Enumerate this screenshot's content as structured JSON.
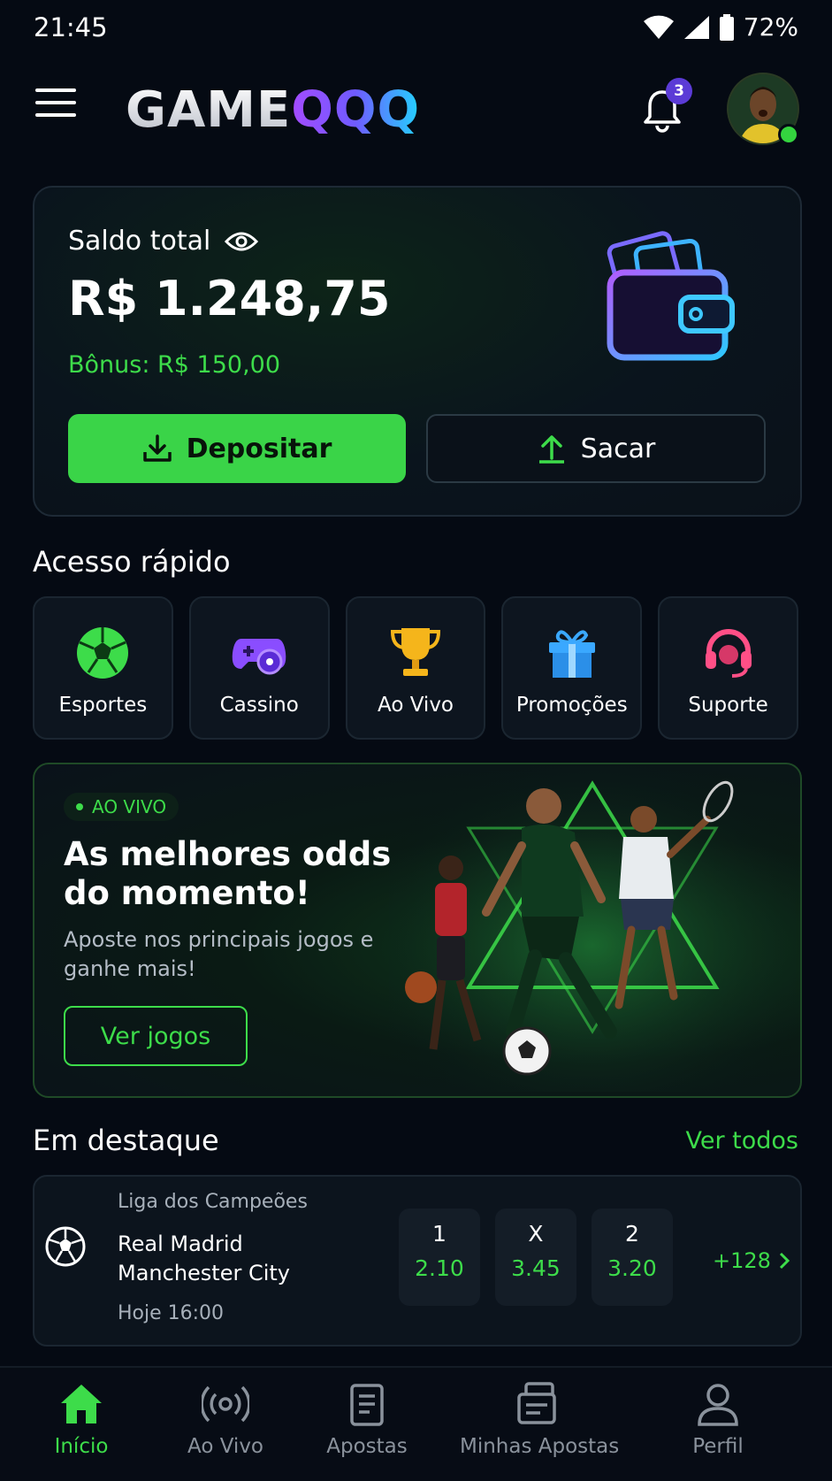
{
  "status_bar": {
    "time": "21:45",
    "battery": "72%"
  },
  "header": {
    "logo_part1": "GAME",
    "logo_part2": "QQQ",
    "notification_count": "3"
  },
  "balance": {
    "label": "Saldo total",
    "value": "R$ 1.248,75",
    "bonus": "Bônus: R$ 150,00",
    "deposit_label": "Depositar",
    "withdraw_label": "Sacar"
  },
  "quick_access": {
    "title": "Acesso rápido",
    "items": [
      {
        "label": "Esportes",
        "icon": "soccer-ball-icon"
      },
      {
        "label": "Cassino",
        "icon": "gamepad-icon"
      },
      {
        "label": "Ao Vivo",
        "icon": "trophy-icon"
      },
      {
        "label": "Promoções",
        "icon": "gift-icon"
      },
      {
        "label": "Suporte",
        "icon": "headset-icon"
      }
    ]
  },
  "promo": {
    "tag": "AO VIVO",
    "title": "As melhores odds do momento!",
    "subtitle": "Aposte nos principais jogos e ganhe mais!",
    "button": "Ver jogos"
  },
  "featured": {
    "title": "Em destaque",
    "see_all": "Ver todos",
    "match": {
      "league": "Liga dos Campeões",
      "home": "Real Madrid",
      "away": "Manchester City",
      "time": "Hoje 16:00",
      "odds": [
        {
          "label": "1",
          "value": "2.10"
        },
        {
          "label": "X",
          "value": "3.45"
        },
        {
          "label": "2",
          "value": "3.20"
        }
      ],
      "more_markets": "+128"
    }
  },
  "bottom_nav": [
    {
      "label": "Início",
      "icon": "home-icon",
      "active": true
    },
    {
      "label": "Ao Vivo",
      "icon": "broadcast-icon"
    },
    {
      "label": "Apostas",
      "icon": "clipboard-icon"
    },
    {
      "label": "Minhas Apostas",
      "icon": "tickets-icon"
    },
    {
      "label": "Perfil",
      "icon": "user-icon"
    }
  ],
  "colors": {
    "accent": "#3ddc4a",
    "background": "#050a13",
    "card": "#0c141d"
  }
}
